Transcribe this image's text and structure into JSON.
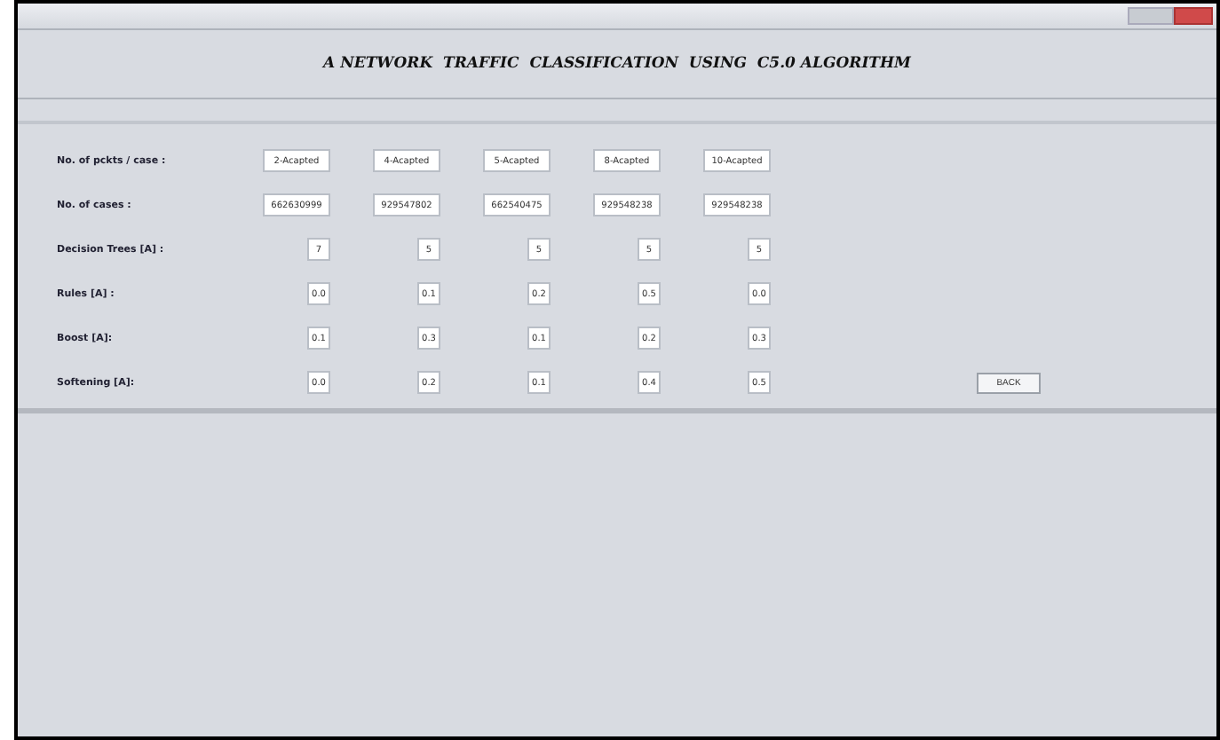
{
  "window": {
    "title": "A NETWORK  TRAFFIC  CLASSIFICATION  USING  C5.0 ALGORITHM"
  },
  "rows": [
    {
      "label": "No. of pckts / case :",
      "kind": "wide",
      "values": [
        "2-Acapted",
        "4-Acapted",
        "5-Acapted",
        "8-Acapted",
        "10-Acapted"
      ]
    },
    {
      "label": "No. of cases :",
      "kind": "wide",
      "values": [
        "662630999",
        "929547802",
        "662540475",
        "929548238",
        "929548238"
      ]
    },
    {
      "label": "Decision Trees [A] :",
      "kind": "small",
      "values": [
        "7",
        "5",
        "5",
        "5",
        "5"
      ]
    },
    {
      "label": "Rules [A] :",
      "kind": "small",
      "values": [
        "0.0",
        "0.1",
        "0.2",
        "0.5",
        "0.0"
      ]
    },
    {
      "label": "Boost [A]:",
      "kind": "small",
      "values": [
        "0.1",
        "0.3",
        "0.1",
        "0.2",
        "0.3"
      ]
    },
    {
      "label": "Softening [A]:",
      "kind": "small",
      "values": [
        "0.0",
        "0.2",
        "0.1",
        "0.4",
        "0.5"
      ]
    }
  ],
  "buttons": [
    "BACK"
  ]
}
